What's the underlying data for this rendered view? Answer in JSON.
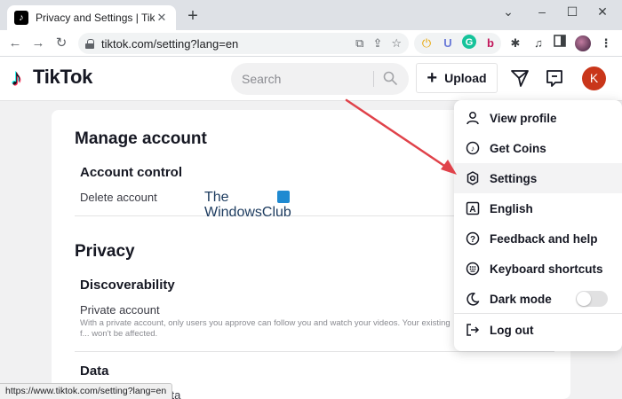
{
  "browser": {
    "tab_title": "Privacy and Settings | TikTok",
    "tab_close": "✕",
    "new_tab": "+",
    "url": "tiktok.com/setting?lang=en",
    "status_url": "https://www.tiktok.com/setting?lang=en",
    "window_controls": {
      "collapse": "⌄",
      "minimize": "–",
      "maximize": "☐",
      "close": "✕"
    }
  },
  "header": {
    "logo_text": "TikTok",
    "search_placeholder": "Search",
    "upload_label": "Upload",
    "avatar_letter": "K"
  },
  "settings": {
    "manage_account": {
      "title": "Manage account",
      "account_control": "Account control",
      "delete_account": "Delete account"
    },
    "privacy": {
      "title": "Privacy",
      "discoverability": "Discoverability",
      "private_account": "Private account",
      "private_account_desc": "With a private account, only users you approve can follow you and watch your videos. Your existing f... won't be affected."
    },
    "data": {
      "title": "Data",
      "partial_item": "data"
    }
  },
  "watermark": {
    "line1": "The",
    "line2": "WindowsClub"
  },
  "menu": {
    "items": [
      {
        "label": "View profile",
        "icon": "person-icon"
      },
      {
        "label": "Get Coins",
        "icon": "coin-icon"
      },
      {
        "label": "Settings",
        "icon": "gear-icon"
      },
      {
        "label": "English",
        "icon": "language-icon"
      },
      {
        "label": "Feedback and help",
        "icon": "help-icon"
      },
      {
        "label": "Keyboard shortcuts",
        "icon": "keyboard-icon"
      },
      {
        "label": "Dark mode",
        "icon": "moon-icon"
      },
      {
        "label": "Log out",
        "icon": "logout-icon"
      }
    ],
    "dark_mode_on": false
  },
  "colors": {
    "accent_red": "#fe2c55",
    "accent_cyan": "#25f4ee",
    "arrow": "#e0424a",
    "avatar": "#c9361a"
  }
}
